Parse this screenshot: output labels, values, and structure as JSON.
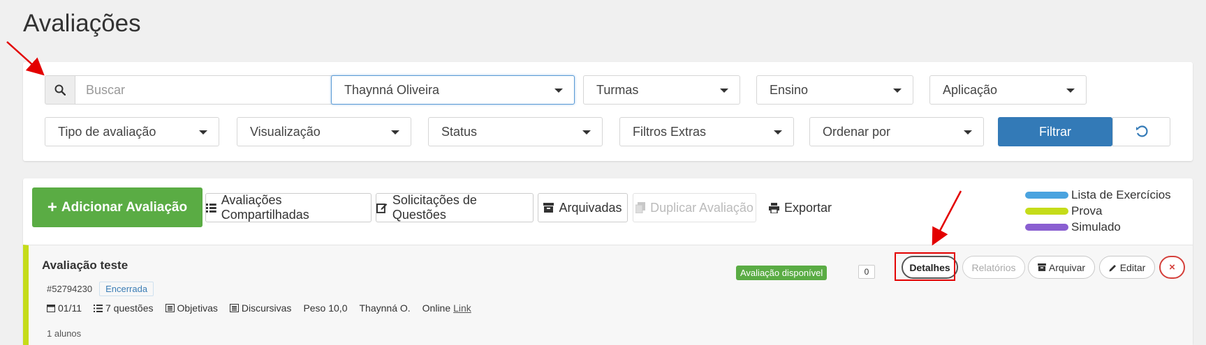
{
  "page": {
    "title": "Avaliações"
  },
  "filters": {
    "search_placeholder": "Buscar",
    "professor": "Thaynná Oliveira",
    "turmas": "Turmas",
    "ensino": "Ensino",
    "aplicacao": "Aplicação",
    "tipo": "Tipo de avaliação",
    "visualizacao": "Visualização",
    "status": "Status",
    "extras": "Filtros Extras",
    "ordenar": "Ordenar por",
    "filter_label": "Filtrar"
  },
  "toolbar": {
    "add_label": "Adicionar Avaliação",
    "shared_label": "Avaliações Compartilhadas",
    "requests_label": "Solicitações de Questões",
    "archived_label": "Arquivadas",
    "duplicate_label": "Duplicar Avaliação",
    "export_label": "Exportar"
  },
  "legend": [
    {
      "label": "Lista de Exercícios",
      "color": "#4aa3df"
    },
    {
      "label": "Prova",
      "color": "#c5dc1a"
    },
    {
      "label": "Simulado",
      "color": "#8a5fd1"
    }
  ],
  "item": {
    "title": "Avaliação teste",
    "id": "#52794230",
    "state": "Encerrada",
    "date": "01/11",
    "questions": "7 questões",
    "objective": "Objetivas",
    "discursive": "Discursivas",
    "weight": "Peso 10,0",
    "author": "Thaynná O.",
    "mode": "Online",
    "link": "Link",
    "students": "1 alunos",
    "availability": "Avaliação disponível",
    "count": "0",
    "details_label": "Detalhes",
    "reports_label": "Relatórios",
    "archive_label": "Arquivar",
    "edit_label": "Editar",
    "close_glyph": "×"
  }
}
